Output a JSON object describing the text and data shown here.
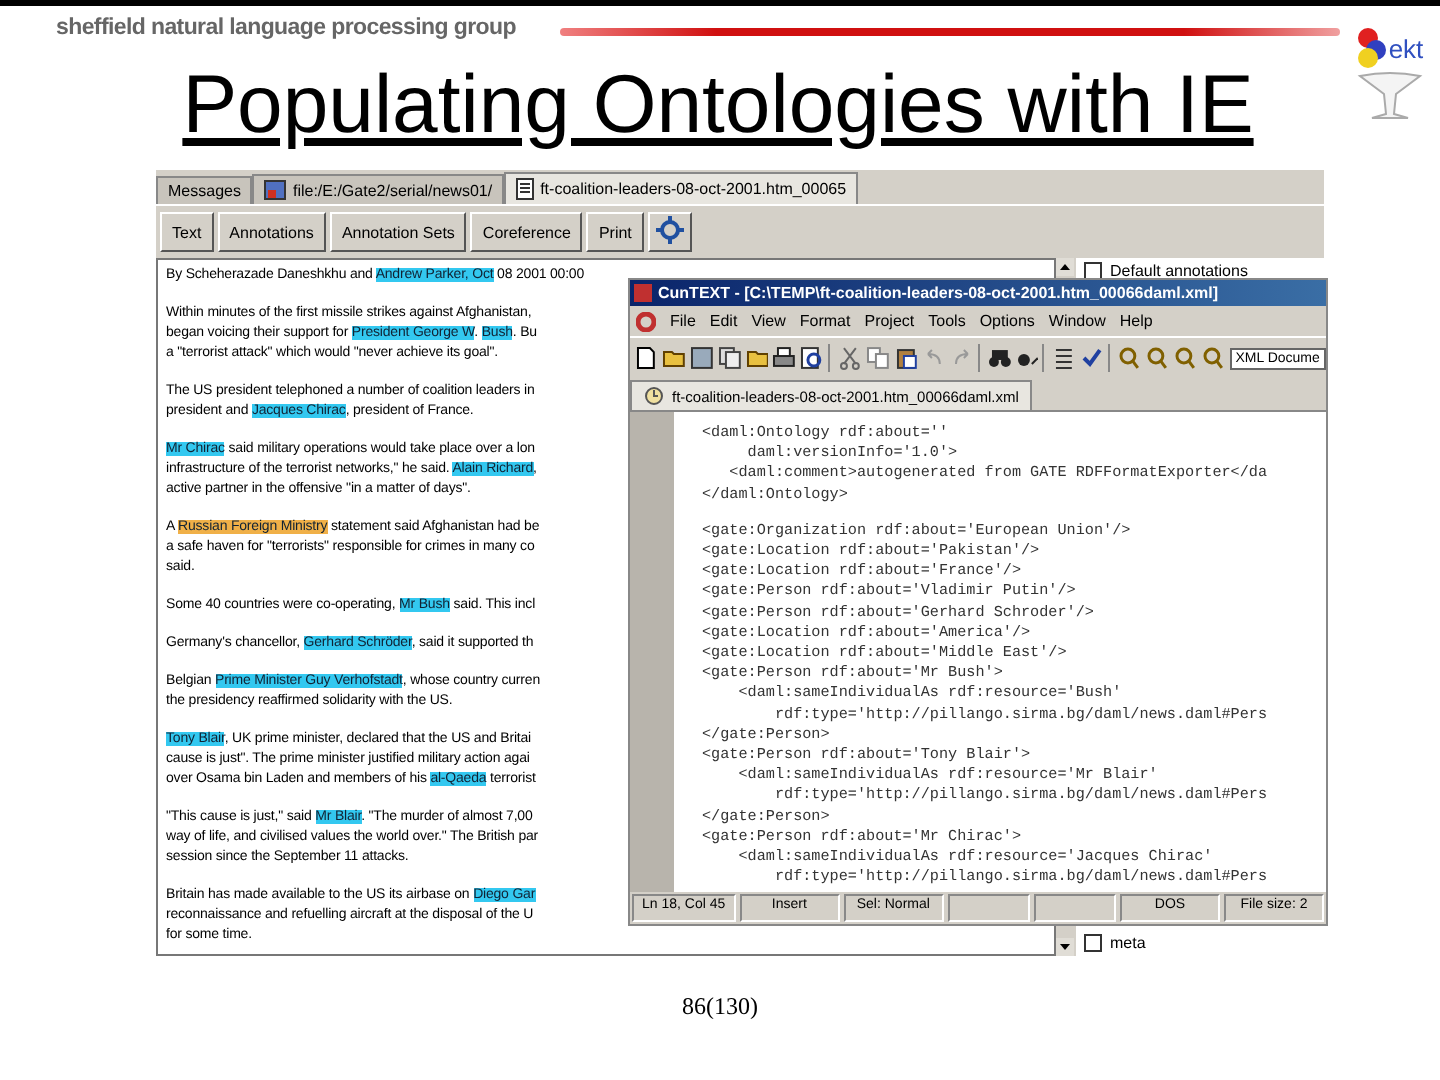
{
  "header": {
    "group_name": "sheffield natural language processing group",
    "logo_text": "ekt"
  },
  "title": "Populating Ontologies with IE",
  "gate": {
    "tabs": [
      {
        "label": "Messages",
        "kind": "plain",
        "selected": false
      },
      {
        "label": "file:/E:/Gate2/serial/news01/",
        "kind": "picture",
        "selected": false
      },
      {
        "label": "ft-coalition-leaders-08-oct-2001.htm_00065",
        "kind": "document",
        "selected": true
      }
    ],
    "buttons": [
      "Text",
      "Annotations",
      "Annotation Sets",
      "Coreference",
      "Print"
    ],
    "document": {
      "paragraphs": [
        {
          "lines": [
            [
              {
                "text": "By Scheherazade Daneshkhu and "
              },
              {
                "text": "Andrew Parker, Oct",
                "color": "#33c8f0"
              },
              {
                "text": " 08 2001 00:00"
              }
            ]
          ]
        },
        {
          "lines": [
            [
              {
                "text": "Within minutes of the first missile strikes against Afghanistan,"
              }
            ],
            [
              {
                "text": "began voicing their support for "
              },
              {
                "text": "President George W",
                "color": "#33c8f0"
              },
              {
                "text": ". "
              },
              {
                "text": "Bush",
                "color": "#33c8f0"
              },
              {
                "text": ". Bu"
              }
            ],
            [
              {
                "text": "a \"terrorist attack\" which would \"never achieve its goal\"."
              }
            ]
          ]
        },
        {
          "lines": [
            [
              {
                "text": "The US president telephoned a number of coalition leaders in"
              }
            ],
            [
              {
                "text": "president and "
              },
              {
                "text": "Jacques Chirac",
                "color": "#33c8f0"
              },
              {
                "text": ", president of France."
              }
            ]
          ]
        },
        {
          "lines": [
            [
              {
                "text": "Mr Chirac",
                "color": "#33c8f0"
              },
              {
                "text": " said military operations would take place over a lon"
              }
            ],
            [
              {
                "text": "infrastructure of the terrorist networks,\" he said. "
              },
              {
                "text": "Alain Richard",
                "color": "#33c8f0"
              },
              {
                "text": ","
              }
            ],
            [
              {
                "text": "active partner in the offensive \"in a matter of days\"."
              }
            ]
          ]
        },
        {
          "lines": [
            [
              {
                "text": "A "
              },
              {
                "text": "Russian Foreign Ministry",
                "color": "#f0b048"
              },
              {
                "text": " statement said Afghanistan had be"
              }
            ],
            [
              {
                "text": "a safe haven for \"terrorists\" responsible for crimes in many co"
              }
            ],
            [
              {
                "text": "said."
              }
            ]
          ]
        },
        {
          "lines": [
            [
              {
                "text": "Some 40 countries were co-operating, "
              },
              {
                "text": "Mr Bush",
                "color": "#33c8f0"
              },
              {
                "text": " said. This incl"
              }
            ]
          ]
        },
        {
          "lines": [
            [
              {
                "text": "Germany's chancellor, "
              },
              {
                "text": "Gerhard Schröder",
                "color": "#33c8f0"
              },
              {
                "text": ", said it supported th"
              }
            ]
          ]
        },
        {
          "lines": [
            [
              {
                "text": "Belgian "
              },
              {
                "text": "Prime Minister Guy Verhofstadt",
                "color": "#33c8f0"
              },
              {
                "text": ", whose country curren"
              }
            ],
            [
              {
                "text": "the presidency reaffirmed solidarity with the US."
              }
            ]
          ]
        },
        {
          "lines": [
            [
              {
                "text": "Tony Blair",
                "color": "#33c8f0"
              },
              {
                "text": ", UK prime minister, declared that the US and Britai"
              }
            ],
            [
              {
                "text": "cause is just\". The prime minister justified military action agai"
              }
            ],
            [
              {
                "text": "over Osama bin Laden and members of his "
              },
              {
                "text": "al-Qaeda",
                "color": "#33c8f0"
              },
              {
                "text": " terrorist"
              }
            ]
          ]
        },
        {
          "lines": [
            [
              {
                "text": "\"This cause is just,\" said "
              },
              {
                "text": "Mr Blair",
                "color": "#33c8f0"
              },
              {
                "text": ". \"The murder of almost 7,00"
              }
            ],
            [
              {
                "text": "way of life, and civilised values the world over.\" The British par"
              }
            ],
            [
              {
                "text": "session since the September 11 attacks."
              }
            ]
          ]
        },
        {
          "lines": [
            [
              {
                "text": "Britain has made available to the US its airbase on "
              },
              {
                "text": "Diego Gar",
                "color": "#33c8f0"
              }
            ],
            [
              {
                "text": "reconnaissance and refuelling aircraft at the disposal of the U"
              }
            ],
            [
              {
                "text": "for some time."
              }
            ]
          ]
        }
      ]
    },
    "annotation_sets": [
      {
        "label": "Default annotations",
        "checked": false
      },
      {
        "label": "meta",
        "checked": false
      }
    ]
  },
  "editor": {
    "title": "CunTEXT - [C:\\TEMP\\ft-coalition-leaders-08-oct-2001.htm_00066daml.xml]",
    "menu": [
      "File",
      "Edit",
      "View",
      "Format",
      "Project",
      "Tools",
      "Options",
      "Window",
      "Help"
    ],
    "doc_type": "XML Docume",
    "doc_tab": "ft-coalition-leaders-08-oct-2001.htm_00066daml.xml",
    "code_blocks": [
      [
        "<daml:Ontology rdf:about=''",
        "     daml:versionInfo='1.0'>",
        "   <daml:comment>autogenerated from GATE RDFFormatExporter</da",
        "</daml:Ontology>"
      ],
      [
        "<gate:Organization rdf:about='European Union'/>",
        "<gate:Location rdf:about='Pakistan'/>",
        "<gate:Location rdf:about='France'/>",
        "<gate:Person rdf:about='Vladimir Putin'/>",
        "<gate:Person rdf:about='Gerhard Schroder'/>",
        "<gate:Location rdf:about='America'/>",
        "<gate:Location rdf:about='Middle East'/>",
        "<gate:Person rdf:about='Mr Bush'>",
        "    <daml:sameIndividualAs rdf:resource='Bush'",
        "        rdf:type='http://pillango.sirma.bg/daml/news.daml#Pers",
        "</gate:Person>",
        "<gate:Person rdf:about='Tony Blair'>",
        "    <daml:sameIndividualAs rdf:resource='Mr Blair'",
        "        rdf:type='http://pillango.sirma.bg/daml/news.daml#Pers",
        "</gate:Person>",
        "<gate:Person rdf:about='Mr Chirac'>",
        "    <daml:sameIndividualAs rdf:resource='Jacques Chirac'",
        "        rdf:type='http://pillango.sirma.bg/daml/news.daml#Pers"
      ]
    ],
    "status_left": [
      "Ln 18, Col 45",
      "Insert",
      "Sel: Normal"
    ],
    "status_right": [
      "DOS",
      "File size: 2"
    ]
  },
  "footer": "86(130)"
}
